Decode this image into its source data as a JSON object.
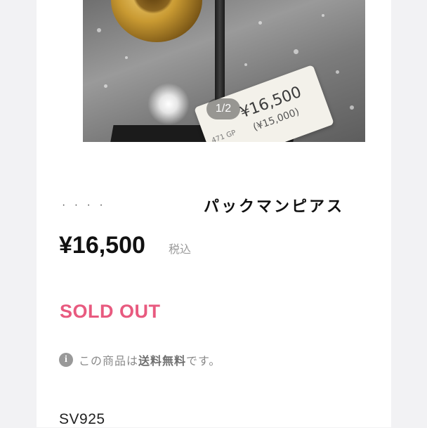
{
  "gallery": {
    "counter": "1/2",
    "tag": {
      "price": "¥16,500",
      "sub": "(¥15,000)",
      "code": "471 GP"
    }
  },
  "product": {
    "brand_ghost": "· · · ·",
    "title": "パックマンピアス",
    "price": "¥16,500",
    "tax_label": "税込",
    "status": "SOLD OUT",
    "status_color": "#e85a7f",
    "shipping": {
      "icon": "info-icon",
      "prefix": "この商品は",
      "emphasis": "送料無料",
      "suffix": "です。"
    },
    "material": "SV925"
  }
}
